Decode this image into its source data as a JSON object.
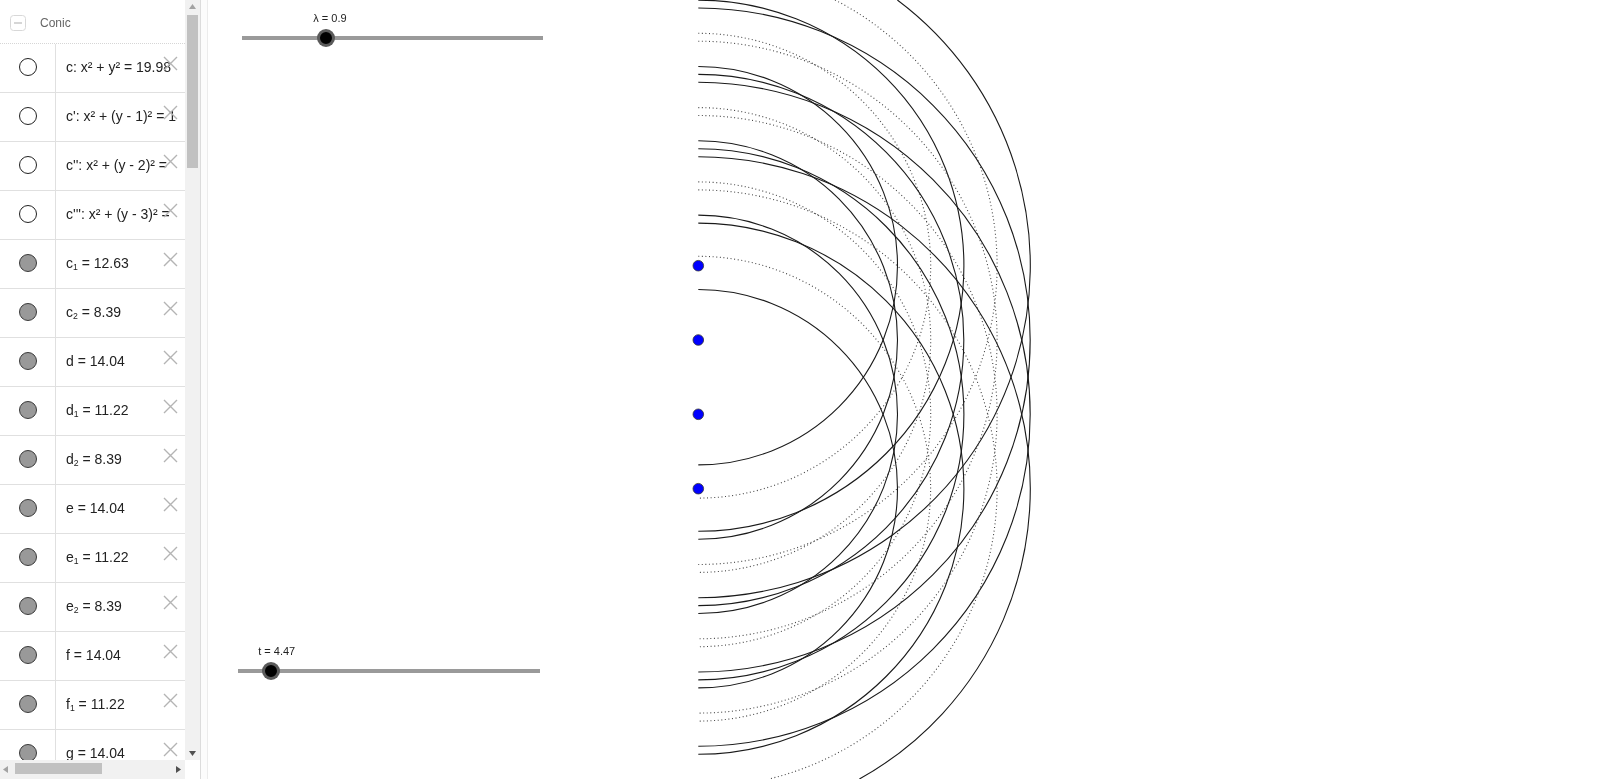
{
  "algebra_view": {
    "group": {
      "label": "Conic",
      "expanded": true
    },
    "items": [
      {
        "label": "c: x² + y² = 19.98",
        "visible": false
      },
      {
        "label": "c': x² + (y - 1)² = 1",
        "visible": false
      },
      {
        "label": "c'': x² + (y - 2)² =",
        "visible": false
      },
      {
        "label": "c''': x² + (y - 3)² =",
        "visible": false
      },
      {
        "label": "c$_{1}$ = 12.63",
        "visible": true
      },
      {
        "label": "c$_{2}$ = 8.39",
        "visible": true
      },
      {
        "label": "d = 14.04",
        "visible": true
      },
      {
        "label": "d$_{1}$ = 11.22",
        "visible": true
      },
      {
        "label": "d$_{2}$ = 8.39",
        "visible": true
      },
      {
        "label": "e = 14.04",
        "visible": true
      },
      {
        "label": "e$_{1}$ = 11.22",
        "visible": true
      },
      {
        "label": "e$_{2}$ = 8.39",
        "visible": true
      },
      {
        "label": "f = 14.04",
        "visible": true
      },
      {
        "label": "f$_{1}$ = 11.22",
        "visible": true
      },
      {
        "label": "g = 14.04",
        "visible": true
      }
    ]
  },
  "graphics_view": {
    "sliders": [
      {
        "label": "λ = 0.9",
        "level": 0.28
      },
      {
        "label": "t = 4.47",
        "level": 0.11
      }
    ]
  }
}
